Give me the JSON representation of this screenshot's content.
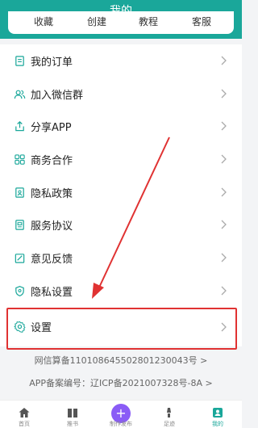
{
  "header": {
    "title": "我的"
  },
  "quick": [
    {
      "label": "收藏"
    },
    {
      "label": "创建"
    },
    {
      "label": "教程"
    },
    {
      "label": "客服"
    }
  ],
  "menu": [
    {
      "label": "我的订单",
      "icon": "order-icon"
    },
    {
      "label": "加入微信群",
      "icon": "group-icon"
    },
    {
      "label": "分享APP",
      "icon": "share-icon"
    },
    {
      "label": "商务合作",
      "icon": "grid-icon"
    },
    {
      "label": "隐私政策",
      "icon": "privacy-doc-icon"
    },
    {
      "label": "服务协议",
      "icon": "agreement-icon"
    },
    {
      "label": "意见反馈",
      "icon": "feedback-icon"
    },
    {
      "label": "隐私设置",
      "icon": "shield-icon"
    },
    {
      "label": "设置",
      "icon": "gear-icon"
    }
  ],
  "footer": {
    "icp_net": "网信算备110108645502801230043号 >",
    "icp_app": "APP备案编号：辽ICP备2021007328号-8A >"
  },
  "tabbar": [
    {
      "label": "首页",
      "icon": "home-icon"
    },
    {
      "label": "推书",
      "icon": "book-icon"
    },
    {
      "label": "制作发布",
      "icon": "plus-icon"
    },
    {
      "label": "足迹",
      "icon": "footprint-icon"
    },
    {
      "label": "我的",
      "icon": "user-icon"
    }
  ],
  "colors": {
    "accent": "#1aa79a",
    "highlight": "#e03232",
    "publish": "#8a5cf6"
  }
}
